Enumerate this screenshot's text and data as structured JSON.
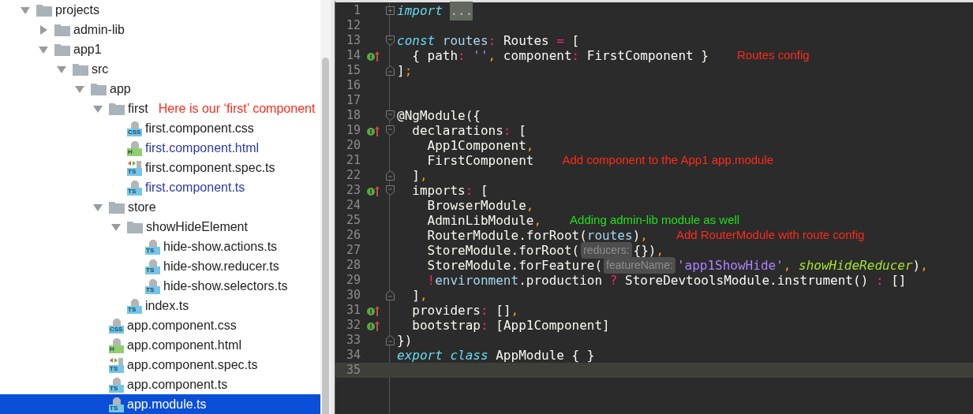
{
  "project_tree": [
    {
      "name": "projects",
      "kind": "folder",
      "expanded": true,
      "selected": false,
      "children": [
        {
          "name": "admin-lib",
          "kind": "folder",
          "expanded": false,
          "selected": false
        },
        {
          "name": "app1",
          "kind": "folder",
          "expanded": true,
          "selected": false,
          "children": [
            {
              "name": "src",
              "kind": "folder",
              "expanded": true,
              "selected": false,
              "children": [
                {
                  "name": "app",
                  "kind": "folder",
                  "expanded": true,
                  "selected": false,
                  "children": [
                    {
                      "name": "first",
                      "kind": "folder",
                      "expanded": true,
                      "selected": false,
                      "note": "Here is our ‘first’ component",
                      "children": [
                        {
                          "name": "first.component.css",
                          "kind": "css",
                          "badge": "CSS",
                          "modified": false,
                          "selected": false
                        },
                        {
                          "name": "first.component.html",
                          "kind": "html",
                          "badge": "H",
                          "modified": true,
                          "selected": false
                        },
                        {
                          "name": "first.component.spec.ts",
                          "kind": "spec",
                          "badge": "TS",
                          "modified": false,
                          "selected": false
                        },
                        {
                          "name": "first.component.ts",
                          "kind": "ts",
                          "badge": "TS",
                          "modified": true,
                          "selected": false
                        }
                      ]
                    },
                    {
                      "name": "store",
                      "kind": "folder",
                      "expanded": true,
                      "selected": false,
                      "children": [
                        {
                          "name": "showHideElement",
                          "kind": "folder",
                          "expanded": true,
                          "selected": false,
                          "children": [
                            {
                              "name": "hide-show.actions.ts",
                              "kind": "ts",
                              "badge": "TS",
                              "modified": false,
                              "selected": false
                            },
                            {
                              "name": "hide-show.reducer.ts",
                              "kind": "ts",
                              "badge": "TS",
                              "modified": false,
                              "selected": false
                            },
                            {
                              "name": "hide-show.selectors.ts",
                              "kind": "ts",
                              "badge": "TS",
                              "modified": false,
                              "selected": false
                            }
                          ]
                        },
                        {
                          "name": "index.ts",
                          "kind": "ts",
                          "badge": "TS",
                          "modified": false,
                          "selected": false
                        }
                      ]
                    },
                    {
                      "name": "app.component.css",
                      "kind": "css",
                      "badge": "CSS",
                      "modified": false,
                      "selected": false
                    },
                    {
                      "name": "app.component.html",
                      "kind": "html",
                      "badge": "H",
                      "modified": false,
                      "selected": false
                    },
                    {
                      "name": "app.component.spec.ts",
                      "kind": "spec",
                      "badge": "TS",
                      "modified": false,
                      "selected": false
                    },
                    {
                      "name": "app.component.ts",
                      "kind": "ts",
                      "badge": "TS",
                      "modified": false,
                      "selected": false
                    },
                    {
                      "name": "app.module.ts",
                      "kind": "ts",
                      "badge": "TS",
                      "modified": false,
                      "selected": true
                    }
                  ]
                }
              ]
            }
          ]
        }
      ]
    }
  ],
  "editor": {
    "lines": [
      {
        "number": "1",
        "override": false,
        "fold": {
          "kind": "collapsed"
        },
        "current": false,
        "tokens": [
          {
            "kind": "keyword",
            "text": "import "
          },
          {
            "kind": "folded",
            "text": "..."
          }
        ]
      },
      {
        "number": "12",
        "override": false,
        "current": false
      },
      {
        "number": "13",
        "override": false,
        "fold": {
          "kind": "open"
        },
        "current": false,
        "tokens": [
          {
            "kind": "keyword",
            "text": "const"
          },
          {
            "kind": "variable",
            "text": " routes"
          },
          {
            "kind": "operator",
            "text": ":"
          },
          {
            "kind": "plain",
            "text": " Routes "
          },
          {
            "kind": "operator",
            "text": "="
          },
          {
            "kind": "plain",
            "text": " ["
          }
        ]
      },
      {
        "number": "14",
        "override": true,
        "current": false,
        "tokens": [
          {
            "kind": "plain",
            "text": "  { path"
          },
          {
            "kind": "operator",
            "text": ": "
          },
          {
            "kind": "string",
            "text": "''"
          },
          {
            "kind": "punct",
            "text": ","
          },
          {
            "kind": "plain",
            "text": " component"
          },
          {
            "kind": "operator",
            "text": ":"
          },
          {
            "kind": "plain",
            "text": " FirstComponent }"
          }
        ],
        "note": {
          "text": "Routes config",
          "color": "#ff2a1a"
        }
      },
      {
        "number": "15",
        "override": false,
        "fold": {
          "kind": "close"
        },
        "current": false,
        "tokens": [
          {
            "kind": "plain",
            "text": "]"
          },
          {
            "kind": "punct",
            "text": ";"
          }
        ]
      },
      {
        "number": "16",
        "override": false,
        "current": false
      },
      {
        "number": "17",
        "override": false,
        "current": false
      },
      {
        "number": "18",
        "override": false,
        "fold": {
          "kind": "open"
        },
        "current": false,
        "tokens": [
          {
            "kind": "plain",
            "text": "@NgModule({"
          }
        ]
      },
      {
        "number": "19",
        "override": true,
        "fold": {
          "kind": "open"
        },
        "current": false,
        "tokens": [
          {
            "kind": "plain",
            "text": "  declarations"
          },
          {
            "kind": "operator",
            "text": ":"
          },
          {
            "kind": "plain",
            "text": " ["
          }
        ]
      },
      {
        "number": "20",
        "override": false,
        "current": false,
        "tokens": [
          {
            "kind": "plain",
            "text": "    App1Component"
          },
          {
            "kind": "punct",
            "text": ","
          }
        ]
      },
      {
        "number": "21",
        "override": false,
        "current": false,
        "tokens": [
          {
            "kind": "plain",
            "text": "    FirstComponent"
          }
        ],
        "note": {
          "text": "Add component to the App1 app.module",
          "color": "#ff2a1a"
        }
      },
      {
        "number": "22",
        "override": false,
        "fold": {
          "kind": "close"
        },
        "current": false,
        "tokens": [
          {
            "kind": "plain",
            "text": "  ]"
          },
          {
            "kind": "punct",
            "text": ","
          }
        ]
      },
      {
        "number": "23",
        "override": true,
        "fold": {
          "kind": "open"
        },
        "current": false,
        "tokens": [
          {
            "kind": "plain",
            "text": "  imports"
          },
          {
            "kind": "operator",
            "text": ":"
          },
          {
            "kind": "plain",
            "text": " ["
          }
        ]
      },
      {
        "number": "24",
        "override": false,
        "current": false,
        "tokens": [
          {
            "kind": "plain",
            "text": "    BrowserModule"
          },
          {
            "kind": "punct",
            "text": ","
          }
        ]
      },
      {
        "number": "25",
        "override": false,
        "current": false,
        "tokens": [
          {
            "kind": "plain",
            "text": "    AdminLibModule"
          },
          {
            "kind": "punct",
            "text": ","
          }
        ],
        "note": {
          "text": "Adding admin-lib module as well",
          "color": "#22e01a"
        }
      },
      {
        "number": "26",
        "override": false,
        "current": false,
        "tokens": [
          {
            "kind": "plain",
            "text": "    RouterModule.forRoot("
          },
          {
            "kind": "variable",
            "text": "routes"
          },
          {
            "kind": "plain",
            "text": ")"
          },
          {
            "kind": "punct",
            "text": ","
          }
        ],
        "note": {
          "text": "Add RouterModule with route config",
          "color": "#ff2a1a"
        }
      },
      {
        "number": "27",
        "override": false,
        "current": false,
        "tokens": [
          {
            "kind": "plain",
            "text": "    StoreModule.forRoot("
          },
          {
            "kind": "hint",
            "text": "reducers:"
          },
          {
            "kind": "plain",
            "text": "{})"
          },
          {
            "kind": "punct",
            "text": ","
          }
        ]
      },
      {
        "number": "28",
        "override": false,
        "current": false,
        "tokens": [
          {
            "kind": "plain",
            "text": "    StoreModule.forFeature("
          },
          {
            "kind": "hint",
            "text": "featureName:"
          },
          {
            "kind": "string",
            "text": "'app1ShowHide'"
          },
          {
            "kind": "punct",
            "text": ", "
          },
          {
            "kind": "reference",
            "text": "showHideReducer"
          },
          {
            "kind": "plain",
            "text": ")"
          },
          {
            "kind": "punct",
            "text": ","
          }
        ]
      },
      {
        "number": "29",
        "override": false,
        "current": false,
        "tokens": [
          {
            "kind": "operator",
            "text": "    !"
          },
          {
            "kind": "variable",
            "text": "environment"
          },
          {
            "kind": "plain",
            "text": ".production "
          },
          {
            "kind": "operator",
            "text": "?"
          },
          {
            "kind": "plain",
            "text": " StoreDevtoolsModule.instrument() "
          },
          {
            "kind": "operator",
            "text": ":"
          },
          {
            "kind": "plain",
            "text": " []"
          }
        ]
      },
      {
        "number": "30",
        "override": false,
        "fold": {
          "kind": "close"
        },
        "current": false,
        "tokens": [
          {
            "kind": "plain",
            "text": "  ]"
          },
          {
            "kind": "punct",
            "text": ","
          }
        ]
      },
      {
        "number": "31",
        "override": true,
        "current": false,
        "tokens": [
          {
            "kind": "plain",
            "text": "  providers"
          },
          {
            "kind": "operator",
            "text": ":"
          },
          {
            "kind": "plain",
            "text": " []"
          },
          {
            "kind": "punct",
            "text": ","
          }
        ]
      },
      {
        "number": "32",
        "override": true,
        "current": false,
        "tokens": [
          {
            "kind": "plain",
            "text": "  bootstrap"
          },
          {
            "kind": "operator",
            "text": ":"
          },
          {
            "kind": "plain",
            "text": " [App1Component]"
          }
        ]
      },
      {
        "number": "33",
        "override": false,
        "fold": {
          "kind": "close"
        },
        "current": false,
        "tokens": [
          {
            "kind": "plain",
            "text": "})"
          }
        ]
      },
      {
        "number": "34",
        "override": false,
        "current": false,
        "tokens": [
          {
            "kind": "keyword",
            "text": "export class"
          },
          {
            "kind": "plain",
            "text": " AppModule { }"
          }
        ]
      },
      {
        "number": "35",
        "override": false,
        "current": true
      }
    ]
  }
}
